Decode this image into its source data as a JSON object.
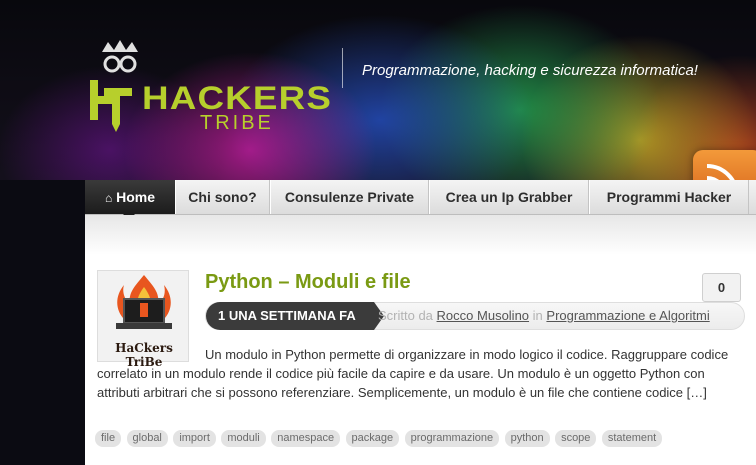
{
  "header": {
    "logo_name": "HACKERS",
    "logo_sub": "TRIBE",
    "tagline": "Programmazione, hacking e sicurezza informatica!"
  },
  "nav": {
    "items": [
      {
        "label": "Home",
        "icon": "home-icon",
        "active": true
      },
      {
        "label": "Chi sono?"
      },
      {
        "label": "Consulenze Private"
      },
      {
        "label": "Crea un Ip Grabber"
      },
      {
        "label": "Programmi Hacker"
      }
    ]
  },
  "post": {
    "thumbnail_text": "HaCkers TriBe",
    "title": "Python – Moduli e file",
    "comment_count": "0",
    "date": "1 UNA SETTIMANA FA",
    "written_by": "Scritto da",
    "author": "Rocco Musolino",
    "in_word": "in",
    "category": "Programmazione e Algoritmi",
    "excerpt": "Un modulo in Python permette di organizzare in modo logico il codice. Raggruppare codice correlato in un modulo rende il codice più facile da capire e da usare. Un modulo è un oggetto Python con attributi arbitrari che si possono referenziare. Semplicemente, un modulo è un file che contiene codice […]",
    "tags": [
      "file",
      "global",
      "import",
      "moduli",
      "namespace",
      "package",
      "programmazione",
      "python",
      "scope",
      "statement"
    ]
  },
  "colors": {
    "accent_green": "#7a9a13",
    "logo_green": "#b7cf2c",
    "rss_orange": "#e67a25"
  }
}
